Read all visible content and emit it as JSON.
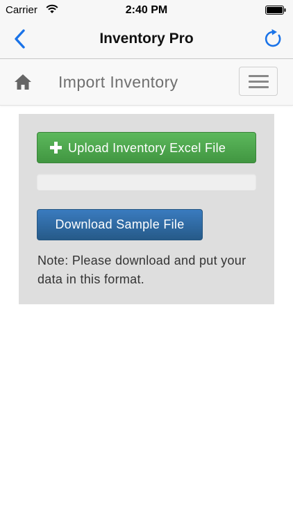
{
  "status_bar": {
    "carrier": "Carrier",
    "time": "2:40 PM",
    "wifi_icon": "wifi-icon",
    "battery_icon": "battery-icon"
  },
  "nav_bar": {
    "title": "Inventory Pro",
    "back_icon": "chevron-left-icon",
    "refresh_icon": "refresh-icon",
    "accent_color": "#1a73e8"
  },
  "page_header": {
    "title": "Import Inventory",
    "home_icon": "home-icon",
    "menu_icon": "hamburger-menu-icon"
  },
  "import_panel": {
    "upload_button_label": "Upload Inventory Excel File",
    "upload_icon": "plus-icon",
    "upload_progress": 0,
    "download_button_label": "Download Sample File",
    "note": "Note: Please download and put your data in this format.",
    "colors": {
      "upload_button": "#5cb85c",
      "download_button": "#337ab7",
      "panel_background": "#dedede"
    }
  }
}
